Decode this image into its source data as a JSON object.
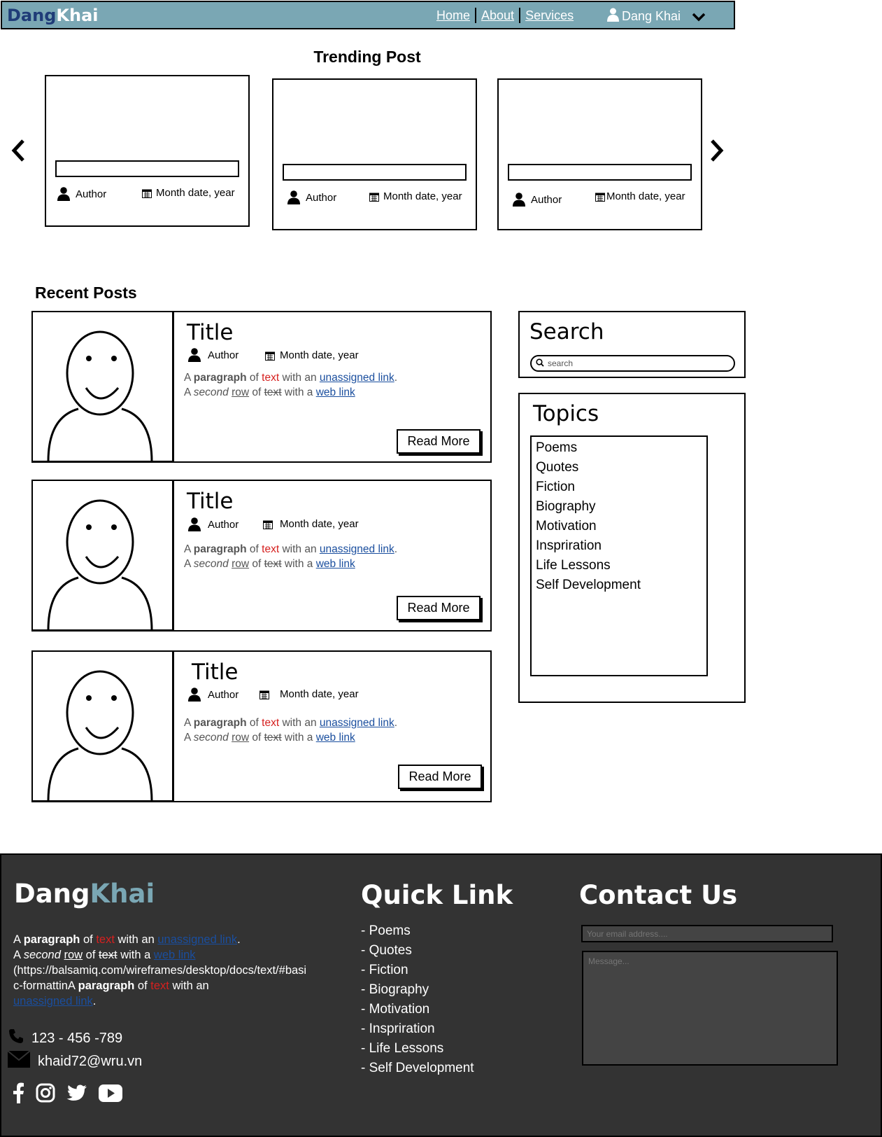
{
  "header": {
    "brand_part1": "Dang",
    "brand_part2": "Khai",
    "nav": [
      "Home",
      "About",
      "Services"
    ],
    "user_name": "Dang Khai",
    "colors": {
      "navbar": "#7aa7b4",
      "brand_dark": "#1f3c78"
    }
  },
  "trending": {
    "title": "Trending Post",
    "cards": [
      {
        "author": "Author",
        "date": "Month date, year"
      },
      {
        "author": "Author",
        "date": "Month date, year"
      },
      {
        "author": "Author",
        "date": "Month date, year"
      }
    ]
  },
  "recent": {
    "title": "Recent Posts",
    "posts": [
      {
        "title": "Title",
        "author": "Author",
        "date": "Month date, year",
        "read_more": "Read More"
      },
      {
        "title": "Title",
        "author": "Author",
        "date": "Month date, year",
        "read_more": "Read More"
      },
      {
        "title": "Title",
        "author": "Author",
        "date": "Month date, year",
        "read_more": "Read More"
      }
    ],
    "para": {
      "a": "A ",
      "paragraph": "paragraph",
      "of": " of ",
      "text": "text",
      "with_an": " with an ",
      "link1": "unassigned link",
      "dot": ".",
      "a2": "A ",
      "second": "second",
      "row": "row",
      "of2": " of ",
      "text2": "text",
      "with_a": " with a ",
      "link2": "web link"
    }
  },
  "sidebar": {
    "search_title": "Search",
    "search_placeholder": "search",
    "topics_title": "Topics",
    "topics": [
      "Poems",
      "Quotes",
      "Fiction",
      "Biography",
      "Motivation",
      "Inspriration",
      "Life Lessons",
      "Self Development"
    ]
  },
  "footer": {
    "brand_part1": "Dang",
    "brand_part2": "Khai",
    "para": {
      "a": "A ",
      "paragraph": "paragraph",
      "of": " of ",
      "text": "text",
      "with_an": " with an ",
      "link1": "unassigned link",
      "dot": ".",
      "a2": "A ",
      "second": "second",
      "row": "row",
      "of2": " of ",
      "text2": "text",
      "with_a": " with a ",
      "link2": "web link",
      "url": "(https://balsamiq.com/wireframes/desktop/docs/text/#basic-formattinA ",
      "paragraph2": "paragraph",
      "of3": " of ",
      "text3": "text",
      "with_an2": " with an ",
      "link3": "unassigned link",
      "dot2": "."
    },
    "phone": "123 - 456 -789",
    "email": "khaid72@wru.vn",
    "social_icons": [
      "facebook-icon",
      "instagram-icon",
      "twitter-icon",
      "youtube-icon"
    ],
    "quick_title": "Quick Link",
    "quick_links": [
      "- Poems",
      "- Quotes",
      "- Fiction",
      "- Biography",
      "- Motivation",
      "- Inspriration",
      "- Life Lessons",
      "- Self Development"
    ],
    "contact_title": "Contact Us",
    "email_placeholder": "Your email address....",
    "message_placeholder": "Message...",
    "colors": {
      "background": "#333333",
      "accent": "#7aa7b4",
      "link": "#1a4e9e",
      "red_text": "#d6201f"
    }
  }
}
